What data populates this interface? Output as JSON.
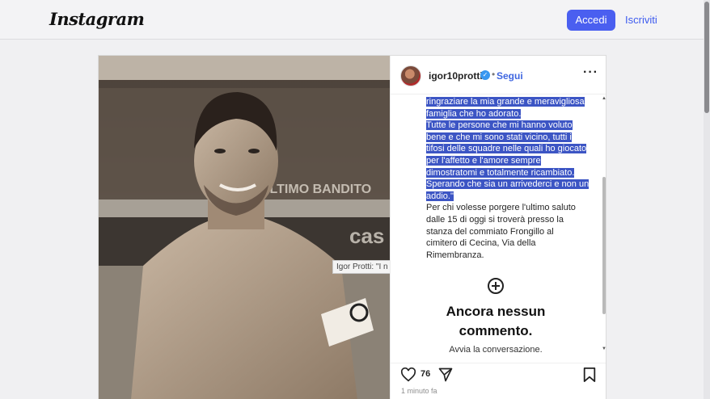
{
  "header": {
    "logo": "Instagram",
    "login_label": "Accedi",
    "signup_label": "Iscriviti"
  },
  "post": {
    "username": "igor10protti",
    "verified_icon": "verified-badge-icon",
    "separator": "•",
    "follow_label": "Segui",
    "more_icon": "···",
    "photo_tooltip": "Igor Protti: \"I n",
    "caption_highlighted": [
      "ringraziare la mia grande e meravigliosa",
      "famiglia che ho adorato.",
      "Tutte le persone che mi hanno voluto",
      "bene e che mi sono stati vicino, tutti i",
      "tifosi delle squadre nelle quali ho giocato",
      "per l'affetto e l'amore sempre",
      "dimostratomi e totalmente ricambiato.",
      "Sperando che sia un arrivederci e non un",
      "addio.\""
    ],
    "caption_plain": [
      "Per chi volesse porgere l'ultimo saluto",
      "dalle 15 di oggi si troverà presso la",
      "stanza del commiato Frongillo al",
      "cimitero di Cecina, Via della",
      "Rimembranza."
    ],
    "no_comments_title": "Ancora nessun commento.",
    "start_conversation": "Avvia la conversazione.",
    "likes_count": "76",
    "time_ago": "1 minuto fa"
  },
  "colors": {
    "accent": "#4a5ff0",
    "highlight": "#3c55c4",
    "link": "#3f66e0"
  }
}
